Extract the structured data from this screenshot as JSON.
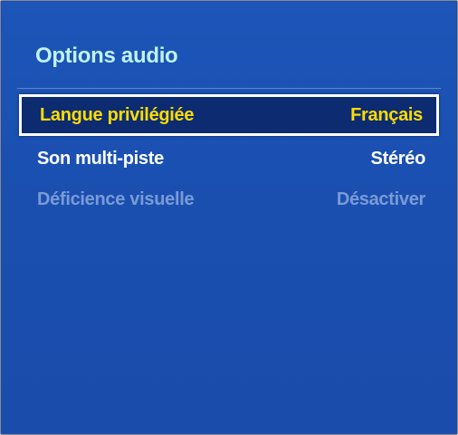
{
  "menu": {
    "title": "Options audio",
    "items": [
      {
        "label": "Langue privilégiée",
        "value": "Français",
        "state": "selected"
      },
      {
        "label": "Son multi-piste",
        "value": "Stéréo",
        "state": "normal"
      },
      {
        "label": "Déficience visuelle",
        "value": "Désactiver",
        "state": "disabled"
      }
    ]
  },
  "colors": {
    "panel_background": "#1b4fb0",
    "title": "#bff2f2",
    "selected_background": "#0c2b70",
    "selected_text": "#ffdc00",
    "normal_text": "#ffffff",
    "disabled_text": "#7a9bd6"
  }
}
